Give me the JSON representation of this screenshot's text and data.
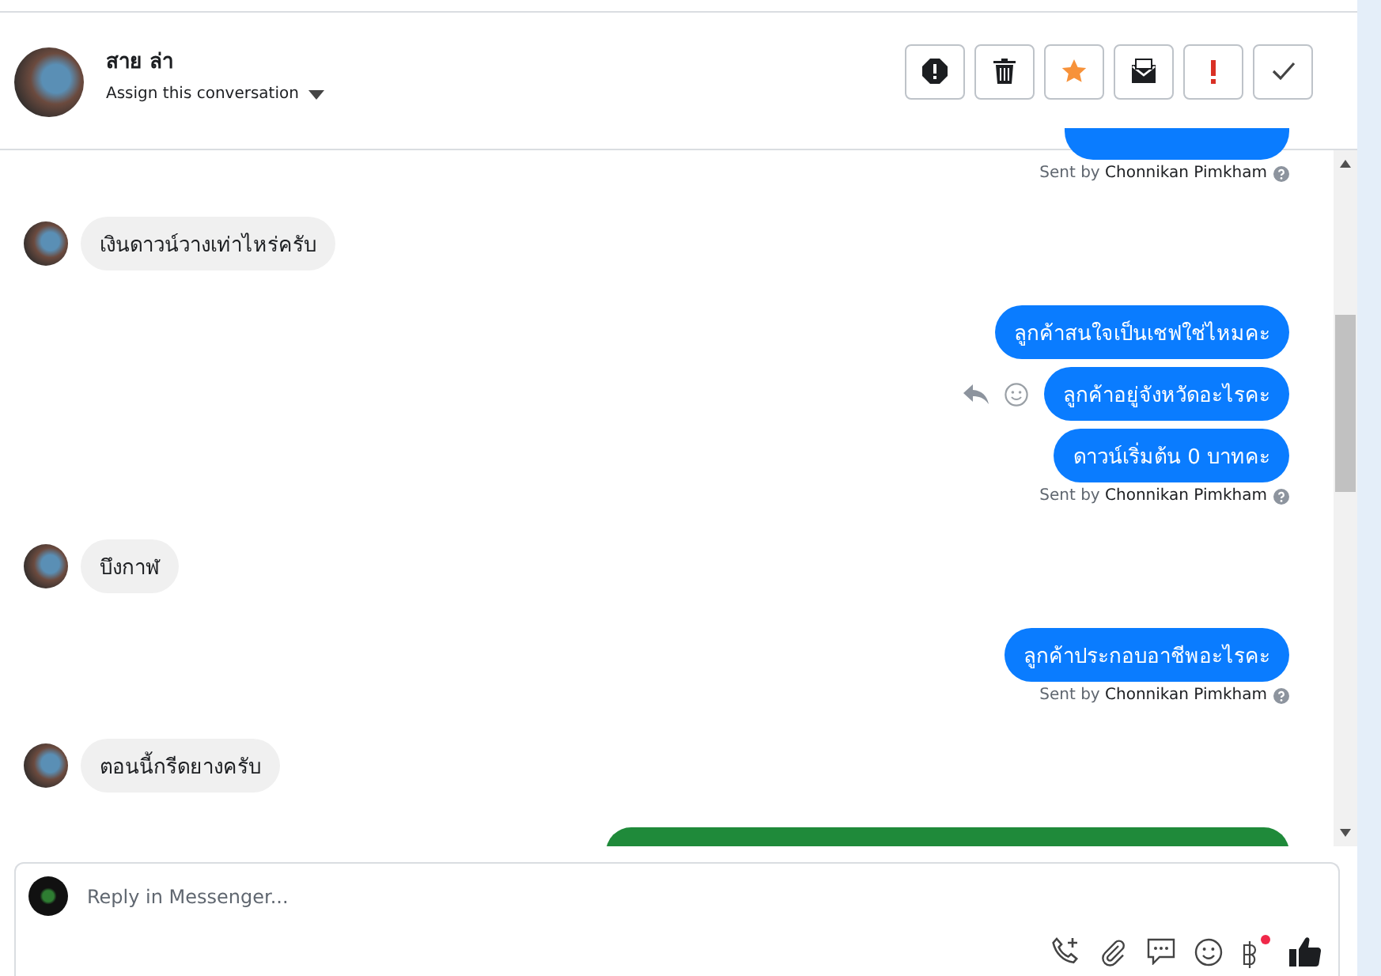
{
  "header": {
    "contact_name": "สาย ล่า",
    "assign_label": "Assign this conversation",
    "actions": [
      {
        "kind": "spam"
      },
      {
        "kind": "delete"
      },
      {
        "kind": "star"
      },
      {
        "kind": "unread"
      },
      {
        "kind": "important"
      },
      {
        "kind": "done"
      }
    ]
  },
  "messages": [
    {
      "kind": "sent-cut"
    },
    {
      "kind": "sent-by",
      "prefix": "Sent by",
      "author": "Chonnikan Pimkham"
    },
    {
      "kind": "received",
      "text": "เงินดาวน์วางเท่าไหร่ครับ"
    },
    {
      "kind": "sent",
      "text": "ลูกค้าสนใจเป็นเชฟใช่ไหมคะ",
      "actions_visible": false
    },
    {
      "kind": "sent",
      "text": "ลูกค้าอยู่จังหวัดอะไรคะ",
      "actions_visible": true
    },
    {
      "kind": "sent",
      "text": "ดาวน์เริ่มต้น 0 บาทคะ",
      "actions_visible": false
    },
    {
      "kind": "sent-by",
      "prefix": "Sent by",
      "author": "Chonnikan Pimkham"
    },
    {
      "kind": "received",
      "text": "บึงกาฬ"
    },
    {
      "kind": "sent",
      "text": "ลูกค้าประกอบอาชีพอะไรคะ",
      "actions_visible": false
    },
    {
      "kind": "sent-by",
      "prefix": "Sent by",
      "author": "Chonnikan Pimkham"
    },
    {
      "kind": "received",
      "text": "ตอนนี้กรีดยางครับ"
    },
    {
      "kind": "image"
    }
  ],
  "composer": {
    "placeholder": "Reply in Messenger...",
    "tools": [
      {
        "kind": "call"
      },
      {
        "kind": "attach"
      },
      {
        "kind": "chat"
      },
      {
        "kind": "emoji"
      },
      {
        "kind": "payment",
        "badge": true
      },
      {
        "kind": "like"
      }
    ]
  }
}
